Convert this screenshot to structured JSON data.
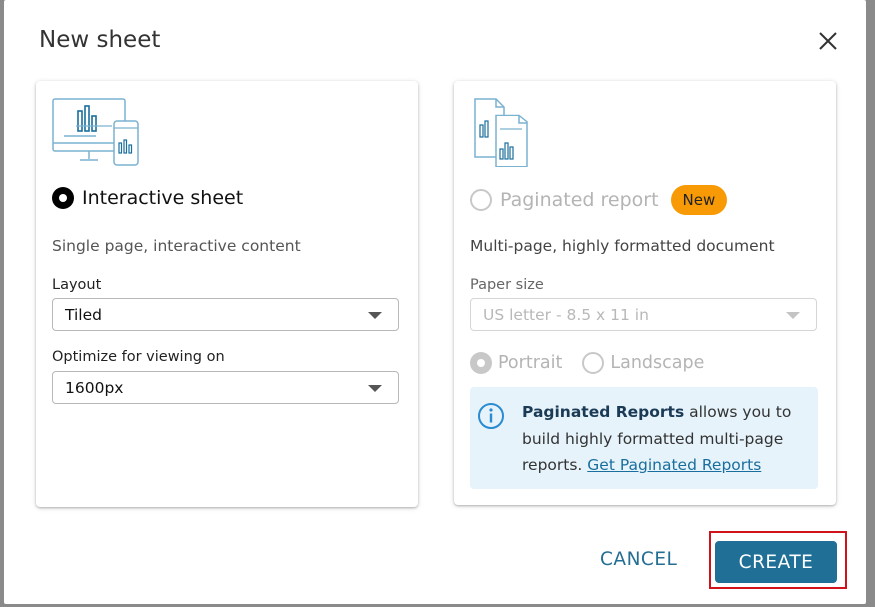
{
  "dialog": {
    "title": "New sheet"
  },
  "interactive": {
    "label": "Interactive sheet",
    "description": "Single page, interactive content",
    "layout_label": "Layout",
    "layout_value": "Tiled",
    "optimize_label": "Optimize for viewing on",
    "optimize_value": "1600px"
  },
  "paginated": {
    "label": "Paginated report",
    "badge": "New",
    "description": "Multi-page, highly formatted document",
    "paper_label": "Paper size",
    "paper_value": "US letter - 8.5 x 11 in",
    "portrait": "Portrait",
    "landscape": "Landscape",
    "info_bold": "Paginated Reports",
    "info_text": " allows you to build highly formatted multi-page reports. ",
    "info_link": "Get Paginated Reports"
  },
  "footer": {
    "cancel": "CANCEL",
    "create": "CREATE"
  },
  "colors": {
    "accent": "#1f6f97",
    "badge": "#f89a06",
    "highlight_border": "#d1121b",
    "info_bg": "#e6f3fb"
  },
  "icons": [
    "close-icon",
    "dashboard-device-icon",
    "paginated-report-icon",
    "info-icon",
    "chevron-down-icon"
  ]
}
